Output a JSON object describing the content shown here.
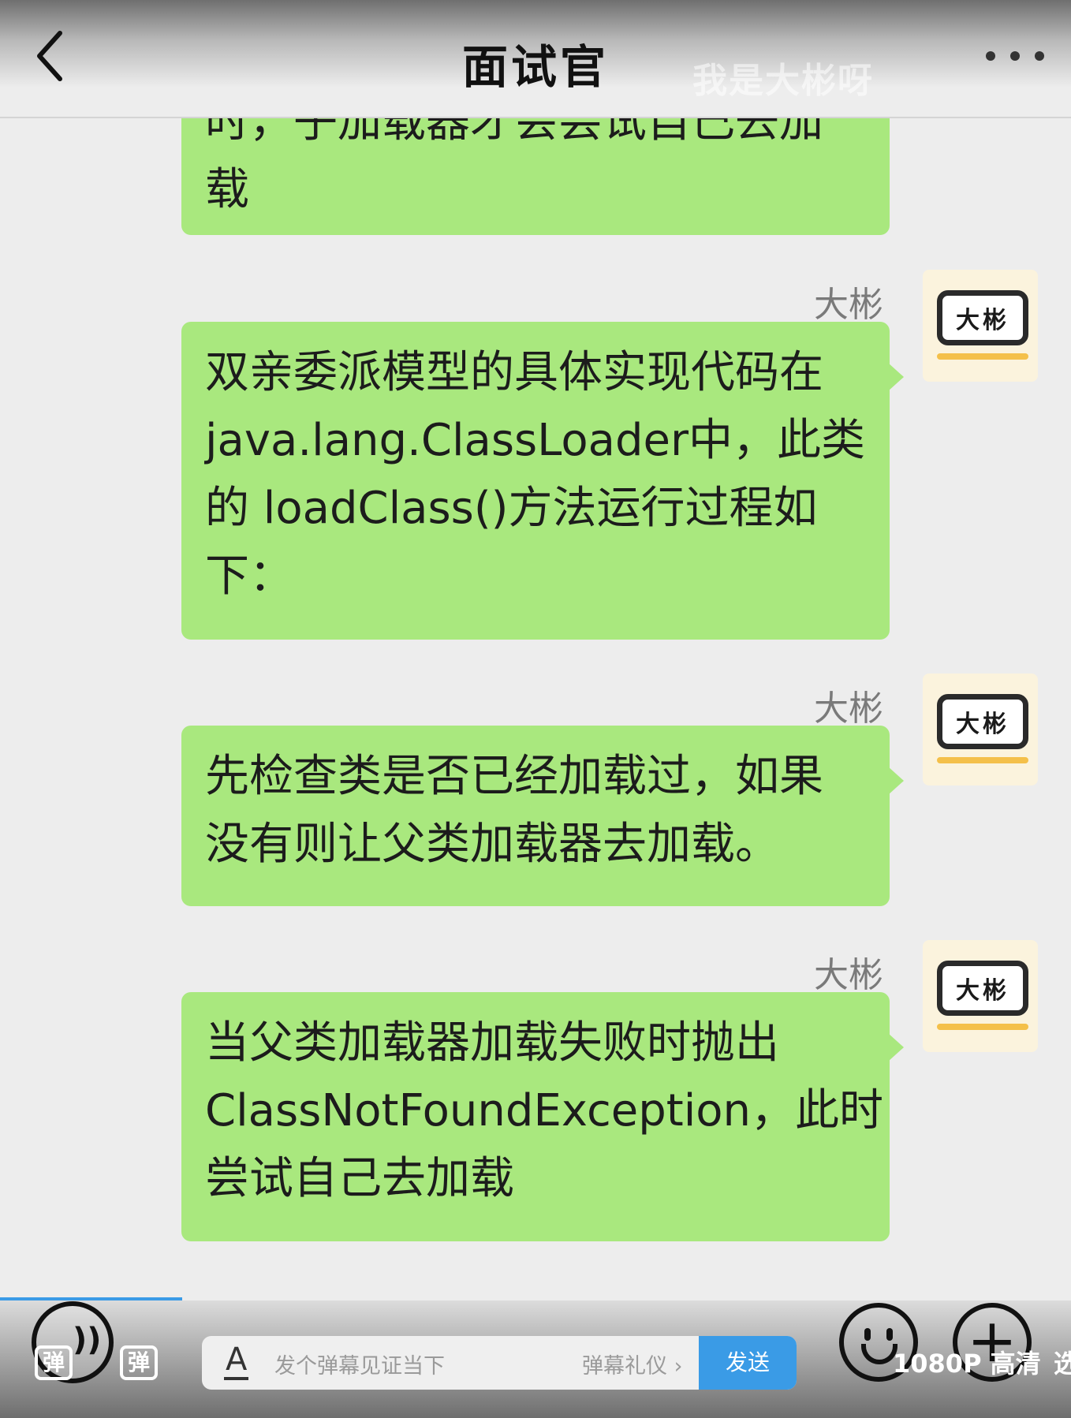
{
  "header": {
    "title": "面试官",
    "watermark": "我是大彬呀",
    "back_icon": "chevron-left-icon",
    "more_icon": "ellipsis-icon"
  },
  "messages": [
    {
      "sender": "",
      "lines": [
        "时，子加载器才会尝试自己去加",
        "载"
      ]
    },
    {
      "sender": "大彬",
      "avatar_text": "大彬",
      "lines": [
        "双亲委派模型的具体实现代码在",
        "java.lang.ClassLoader中，此类",
        "的 loadClass()方法运行过程如",
        "下："
      ]
    },
    {
      "sender": "大彬",
      "avatar_text": "大彬",
      "lines": [
        "先检查类是否已经加载过，如果",
        "没有则让父类加载器去加载。"
      ]
    },
    {
      "sender": "大彬",
      "avatar_text": "大彬",
      "lines": [
        "当父类加载器加载失败时抛出",
        "ClassNotFoundException，此时",
        "尝试自己去加载"
      ]
    }
  ],
  "player": {
    "progress_fraction": 0.17,
    "danmaku_on_label": "弹",
    "danmaku_settings_label": "弹",
    "input_icon": "A",
    "input_placeholder": "发个弹幕见证当下",
    "gift_label": "弹幕礼仪 ›",
    "send_label": "发送",
    "quality_label": "1080P 高清",
    "speed_label": "选",
    "colors": {
      "accent": "#3a9be6",
      "bubble": "#a9e87e"
    }
  }
}
